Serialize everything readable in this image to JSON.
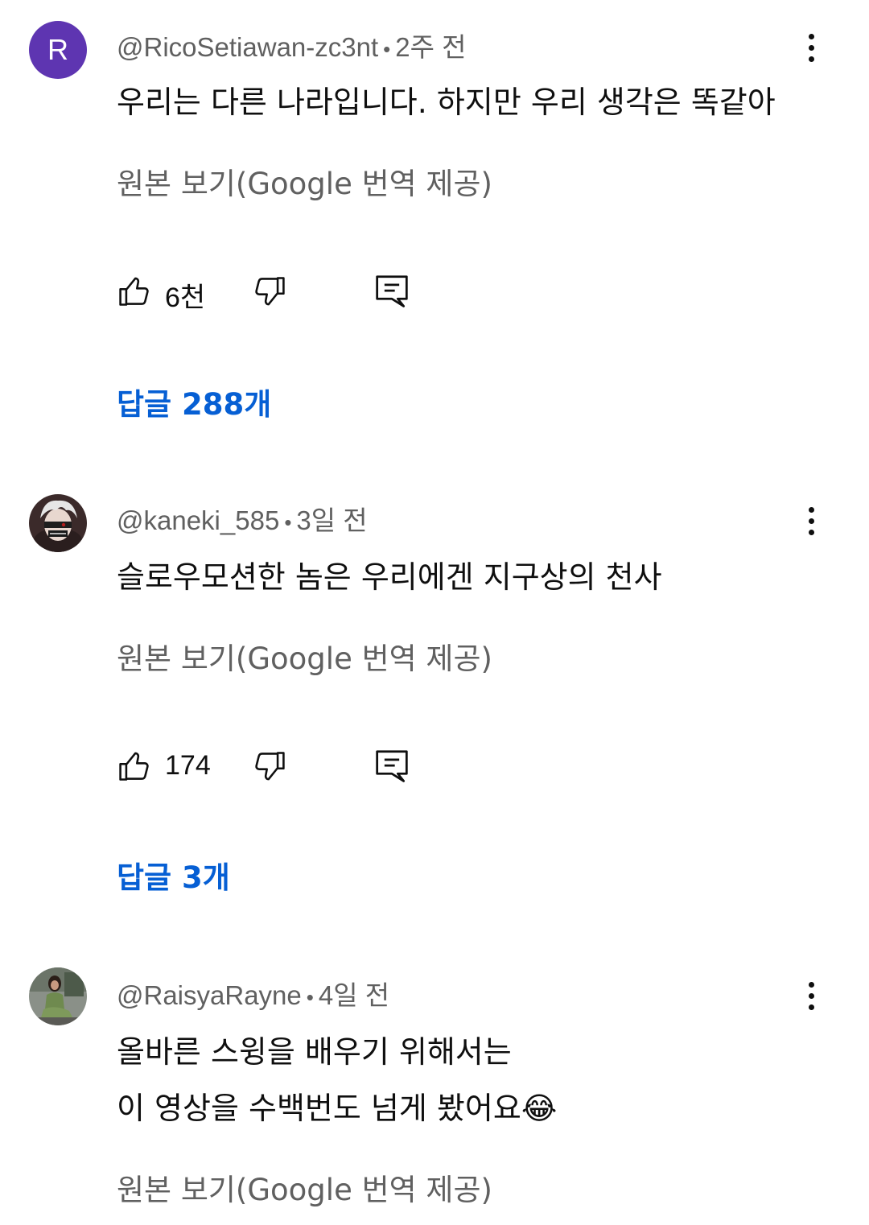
{
  "comments": [
    {
      "avatar_letter": "R",
      "author": "@RicoSetiawan-zc3nt",
      "time": "2주 전",
      "lines": [
        "우리는 다른 나라입니다. 하지만 우리 생각은 똑같아"
      ],
      "translate_label": "원본 보기(Google 번역 제공)",
      "likes": "6천",
      "replies_label": "답글 288개"
    },
    {
      "avatar_icon": "anime-character-avatar",
      "author": "@kaneki_585",
      "time": "3일 전",
      "lines": [
        "슬로우모션한 놈은 우리에겐 지구상의 천사"
      ],
      "translate_label": "원본 보기(Google 번역 제공)",
      "likes": "174",
      "replies_label": "답글 3개"
    },
    {
      "avatar_icon": "user-photo-avatar",
      "author": "@RaisyaRayne",
      "time": "4일 전",
      "lines": [
        "올바른 스윙을 배우기 위해서는",
        "이 영상을 수백번도 넘게 봤어요"
      ],
      "emoji": "😂",
      "translate_label": "원본 보기(Google 번역 제공)"
    }
  ],
  "separator": "•",
  "colors": {
    "link": "#065fd4",
    "secondary_text": "#606060",
    "primary_text": "#0f0f0f",
    "avatar_r": "#5e35b1"
  }
}
